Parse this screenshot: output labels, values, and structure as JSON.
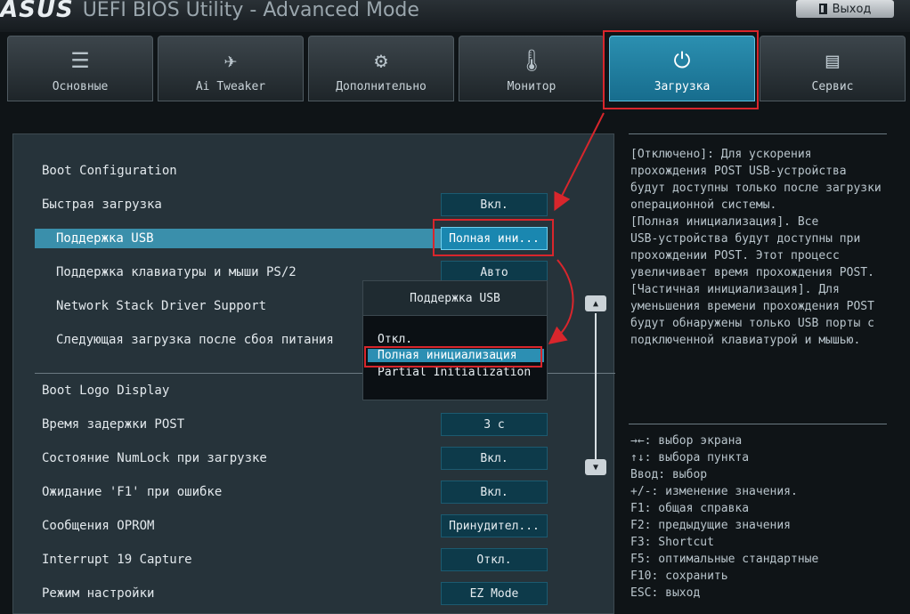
{
  "header": {
    "brand": "ASUS",
    "title": "UEFI BIOS Utility - Advanced Mode",
    "exit_label": "Выход"
  },
  "tabs": [
    {
      "label": "Основные",
      "icon": "list-icon"
    },
    {
      "label": "Ai Tweaker",
      "icon": "tweaker-icon"
    },
    {
      "label": "Дополнительно",
      "icon": "advanced-icon"
    },
    {
      "label": "Монитор",
      "icon": "monitor-icon"
    },
    {
      "label": "Загрузка",
      "icon": "power-icon"
    },
    {
      "label": "Сервис",
      "icon": "tool-icon"
    }
  ],
  "active_tab": "Загрузка",
  "main": {
    "section_title": "Boot Configuration",
    "items": [
      {
        "label": "Быстрая загрузка",
        "value": "Вкл."
      },
      {
        "label": "Поддержка USB",
        "value": "Полная ини..."
      },
      {
        "label": "Поддержка клавиатуры и мыши PS/2",
        "value": "Авто"
      },
      {
        "label": "Network Stack Driver Support",
        "value": ""
      },
      {
        "label": "Следующая загрузка после сбоя питания",
        "value": ""
      }
    ],
    "items2": [
      {
        "label": "Boot Logo Display",
        "value": ""
      },
      {
        "label": "Время задержки POST",
        "value": "3 с"
      },
      {
        "label": "Состояние NumLock при загрузке",
        "value": "Вкл."
      },
      {
        "label": "Ожидание 'F1' при ошибке",
        "value": "Вкл."
      },
      {
        "label": "Сообщения OPROM",
        "value": "Принудител..."
      },
      {
        "label": "Interrupt 19 Capture",
        "value": "Откл."
      },
      {
        "label": "Режим настройки",
        "value": "EZ Mode"
      }
    ]
  },
  "dropdown": {
    "title": "Поддержка USB",
    "options": [
      "Откл.",
      "Полная инициализация",
      "Partial Initialization"
    ],
    "selected": "Полная инициализация"
  },
  "help": {
    "lines": [
      "[Отключено]: Для ускорения",
      "прохождения POST USB-устройства",
      "будут доступны только после загрузки",
      "операционной системы.",
      " [Полная инициализация]. Все",
      "USB-устройства будут доступны при",
      "прохождении POST. Этот процесс",
      "увеличивает время прохождения POST.",
      " [Частичная инициализация]. Для",
      "уменьшения времени прохождения POST",
      "будут обнаружены только USB порты с",
      "подключенной клавиатурой и мышью."
    ]
  },
  "keys": [
    "→←: выбор экрана",
    "↑↓: выбора пункта",
    "Ввод: выбор",
    "+/-: изменение значения.",
    "F1: общая справка",
    "F2: предыдущие значения",
    "F3: Shortcut",
    "F5: оптимальные стандартные",
    "F10: сохранить",
    "ESC: выход"
  ],
  "colors": {
    "accent": "#2b8fb0",
    "highlight": "#d8262c",
    "value_bg": "#0d3a4a"
  }
}
